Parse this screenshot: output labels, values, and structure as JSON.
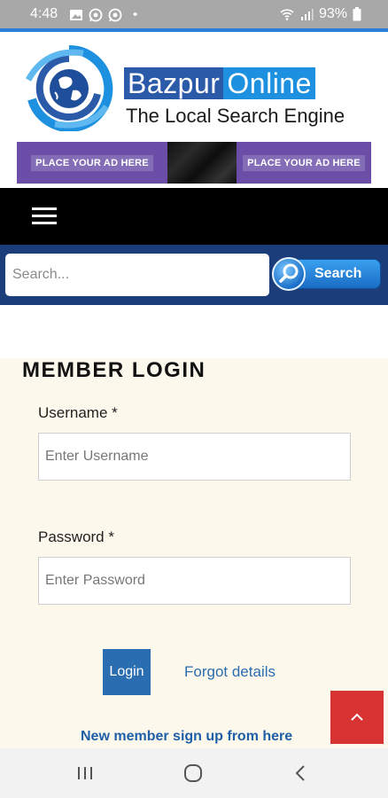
{
  "status_bar": {
    "time": "4:48",
    "battery": "93%",
    "dot": "•",
    "icons": [
      "image-icon",
      "whatsapp-icon",
      "whatsapp-icon",
      "wifi-icon",
      "signal-icon",
      "battery-icon"
    ]
  },
  "header": {
    "brand_part1": "Bazpur",
    "brand_part2": "Online",
    "tagline": "The Local Search Engine",
    "ad_left": "PLACE YOUR AD HERE",
    "ad_right": "PLACE YOUR AD HERE"
  },
  "search": {
    "placeholder": "Search...",
    "button_label": "Search"
  },
  "login": {
    "title": "MEMBER LOGIN",
    "username_label": "Username *",
    "username_placeholder": "Enter Username",
    "password_label": "Password *",
    "password_placeholder": "Enter Password",
    "login_button": "Login",
    "forgot_link": "Forgot details",
    "signup_link": "New member sign up from here"
  },
  "colors": {
    "nav_bar": "#000000",
    "search_bar": "#1b3d7a",
    "login_button": "#2a6db0",
    "scroll_top": "#d83333",
    "login_background": "#fdf8ec"
  }
}
